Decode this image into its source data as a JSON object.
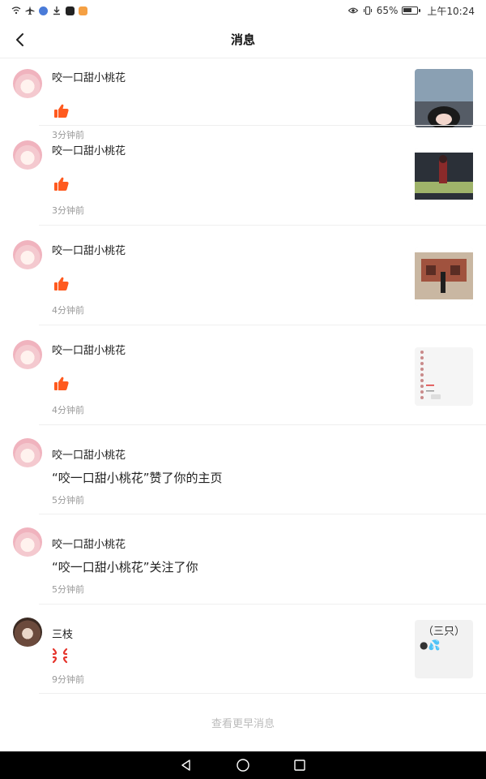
{
  "status_bar": {
    "battery": "65%",
    "time": "上午10:24",
    "battery_level_percent": 65
  },
  "header": {
    "title": "消息",
    "back_icon": "chevron-left-icon"
  },
  "messages": [
    {
      "user": "咬一口甜小桃花",
      "type": "like",
      "time": "3分钟前",
      "avatar": "pink-hair-avatar",
      "thumb": "game-scene-1"
    },
    {
      "user": "咬一口甜小桃花",
      "type": "like",
      "time": "3分钟前",
      "avatar": "pink-hair-avatar",
      "thumb": "game-scene-2"
    },
    {
      "user": "咬一口甜小桃花",
      "type": "like",
      "time": "4分钟前",
      "avatar": "pink-hair-avatar",
      "thumb": "game-scene-3"
    },
    {
      "user": "咬一口甜小桃花",
      "type": "like",
      "time": "4分钟前",
      "avatar": "pink-hair-avatar",
      "thumb": "screenshot-list"
    },
    {
      "user": "咬一口甜小桃花",
      "type": "text",
      "text": "“咬一口甜小桃花”赞了你的主页",
      "time": "5分钟前",
      "avatar": "pink-hair-avatar"
    },
    {
      "user": "咬一口甜小桃花",
      "type": "text",
      "text": "“咬一口甜小桃花”关注了你",
      "time": "5分钟前",
      "avatar": "pink-hair-avatar"
    },
    {
      "user": "三枝",
      "type": "angry",
      "time": "9分钟前",
      "avatar": "dark-hair-avatar",
      "thumb_text": "（三只）",
      "thumb_emoji": "●💦"
    }
  ],
  "more_link": "查看更早消息",
  "colors": {
    "like_orange": "#ff5a1f",
    "time_gray": "#999999",
    "divider": "#efefef",
    "more_link_gray": "#bbbbbb"
  }
}
